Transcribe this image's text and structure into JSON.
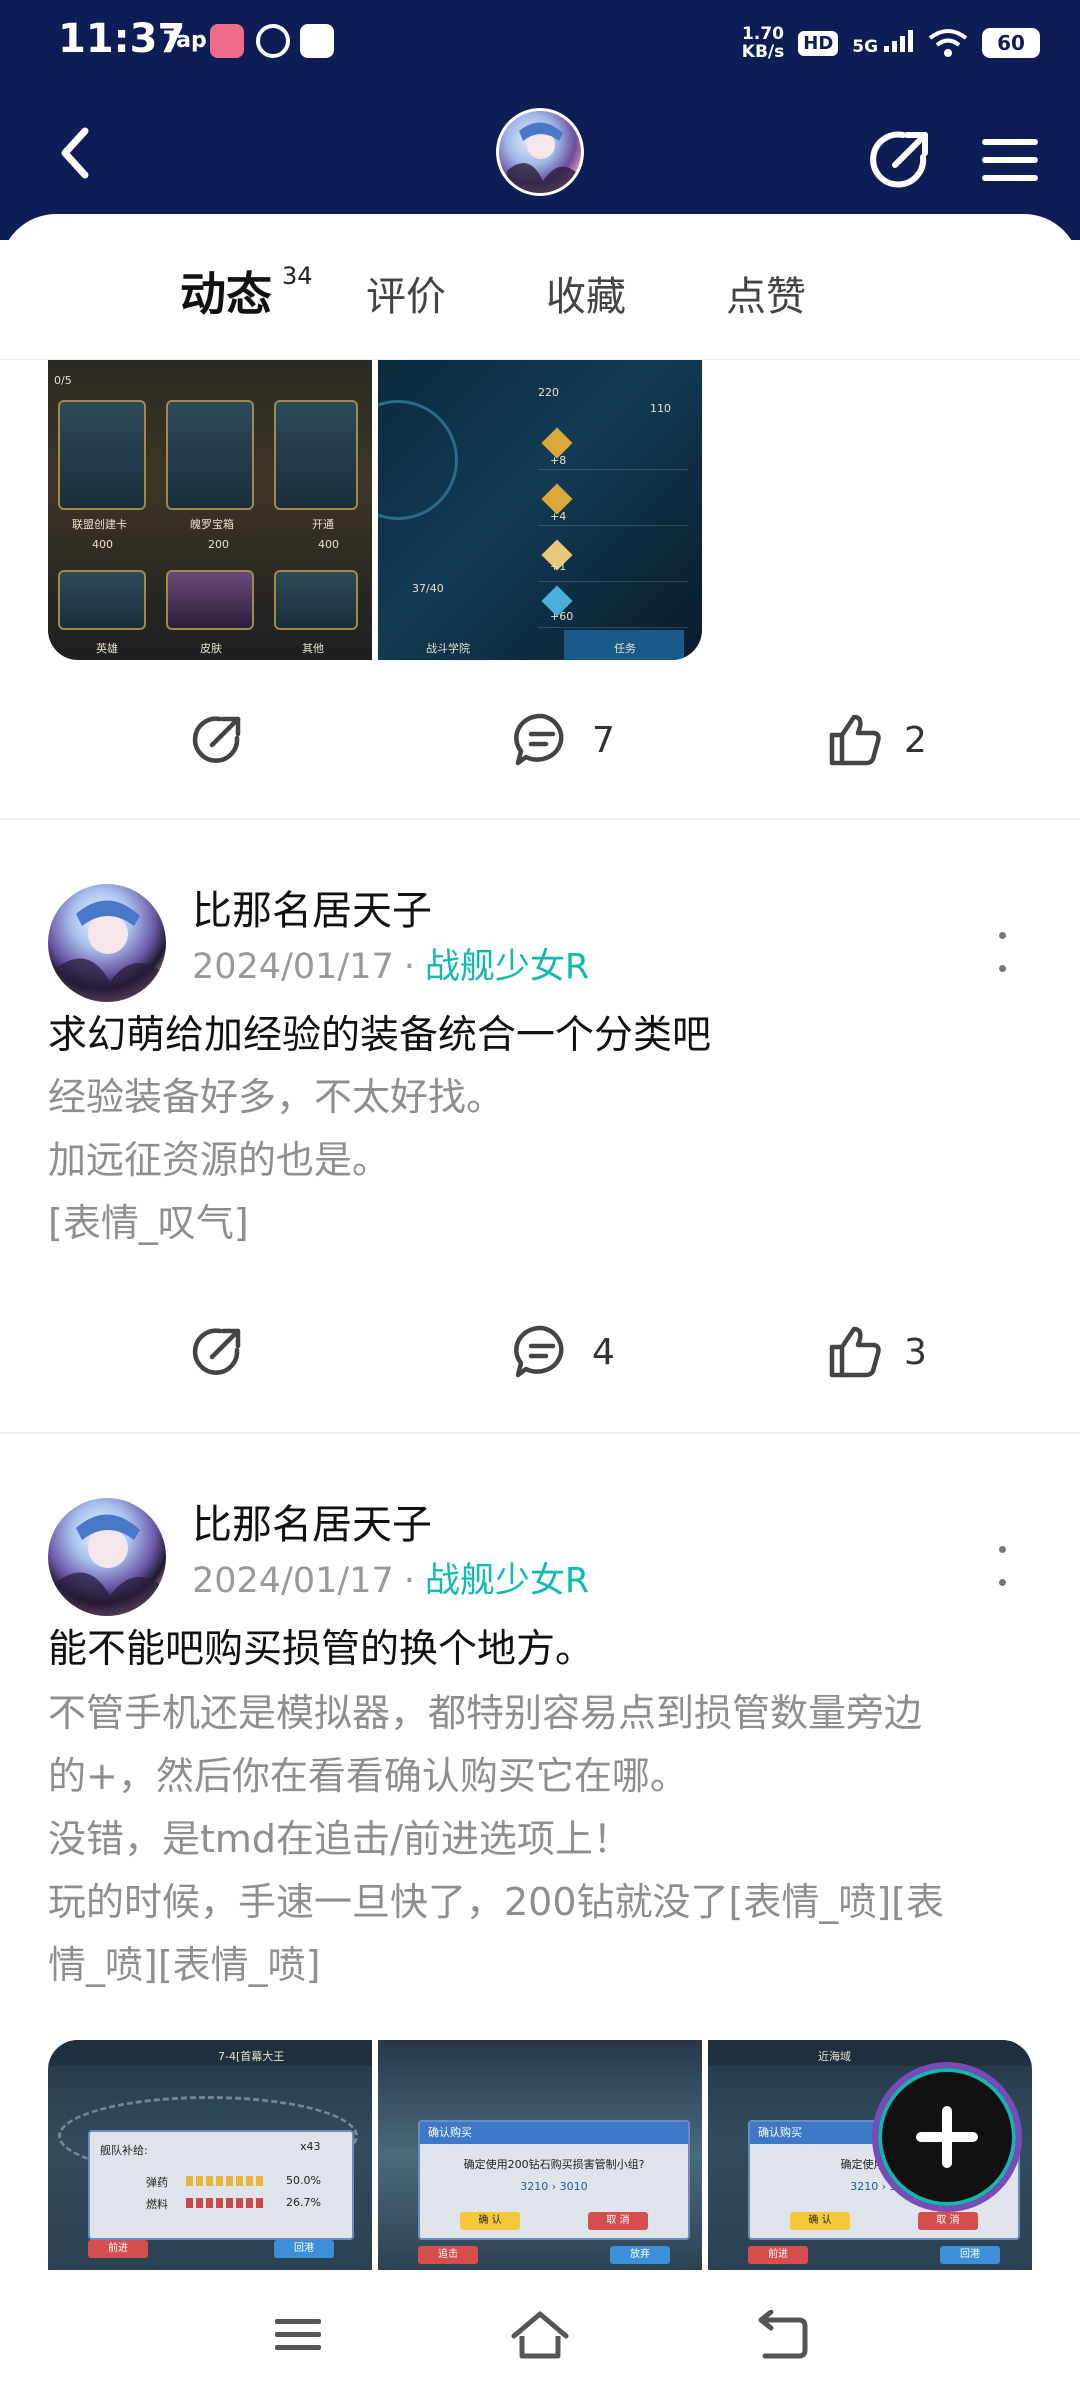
{
  "status_bar": {
    "time": "11:37",
    "app_taptap": "Tap",
    "net_speed_value": "1.70",
    "net_speed_unit": "KB/s",
    "hd": "HD",
    "signal": "5G",
    "battery": "60"
  },
  "header": {
    "back_icon": "chevron-left-icon",
    "share_icon": "share-arrow-icon",
    "menu_icon": "hamburger-menu-icon"
  },
  "tabs": {
    "active_label": "动态",
    "active_count": "34",
    "tab2": "评价",
    "tab3": "收藏",
    "tab4": "点赞"
  },
  "post0": {
    "comments": "7",
    "likes": "2",
    "image1_captions": [
      "联盟创建卡",
      "魄罗宝箱",
      "开通",
      "英雄",
      "皮肤",
      "其他",
      "400",
      "200",
      "400",
      "0/5"
    ],
    "image2_captions": [
      "37/40",
      "战斗学院",
      "任务",
      "220",
      "110",
      "+8",
      "+4",
      "+1",
      "+60"
    ]
  },
  "post1": {
    "author": "比那名居天子",
    "date": "2024/01/17",
    "separator": "·",
    "game": "战舰少女R",
    "title": "求幻萌给加经验的装备统合一个分类吧",
    "body_lines": [
      "经验装备好多，不太好找。",
      "加远征资源的也是。",
      "[表情_叹气]"
    ],
    "comments": "4",
    "likes": "3"
  },
  "post2": {
    "author": "比那名居天子",
    "date": "2024/01/17",
    "separator": "·",
    "game": "战舰少女R",
    "title": "能不能吧购买损管的换个地方。",
    "body_lines": [
      "不管手机还是模拟器，都特别容易点到损管数量旁边",
      "的+，然后你在看看确认购买它在哪。",
      "没错，是tmd在追击/前进选项上！",
      "玩的时候，手速一旦快了，200钻就没了[表情_喷][表",
      "情_喷][表情_喷]"
    ],
    "image_texts": {
      "t1_header": "7-4[首幕大王",
      "t1_supply": "舰队补给:",
      "t1_ammo": "弹药",
      "t1_fuel": "燃料",
      "t1_ammo_pct": "50.0%",
      "t1_fuel_pct": "26.7%",
      "t1_count": "x43",
      "t1_advance": "前进",
      "t1_return": "回港",
      "t2_head": "确认购买",
      "t2_text": "确定使用200钻石购买损害管制小组?",
      "t2_values": "3210 › 3010",
      "t2_confirm": "确 认",
      "t2_cancel": "取 消",
      "t2_pursue": "追击",
      "t2_abandon": "放弃",
      "t3_top": "近海域",
      "t3_head": "确认购买",
      "t3_text": "确定使用200钻石",
      "t3_values": "3210 › 3010",
      "t3_confirm": "确 认",
      "t3_cancel": "取 消",
      "t3_advance": "前进",
      "t3_return": "回港"
    }
  },
  "fab": {
    "icon": "plus-icon"
  },
  "system_nav": {
    "menu_icon": "recent-apps-icon",
    "home_icon": "home-icon",
    "back_icon": "back-icon"
  },
  "colors": {
    "header_bg": "#0e1d55",
    "accent_teal": "#14b8b2",
    "tab_underline": "#14c9c3"
  }
}
